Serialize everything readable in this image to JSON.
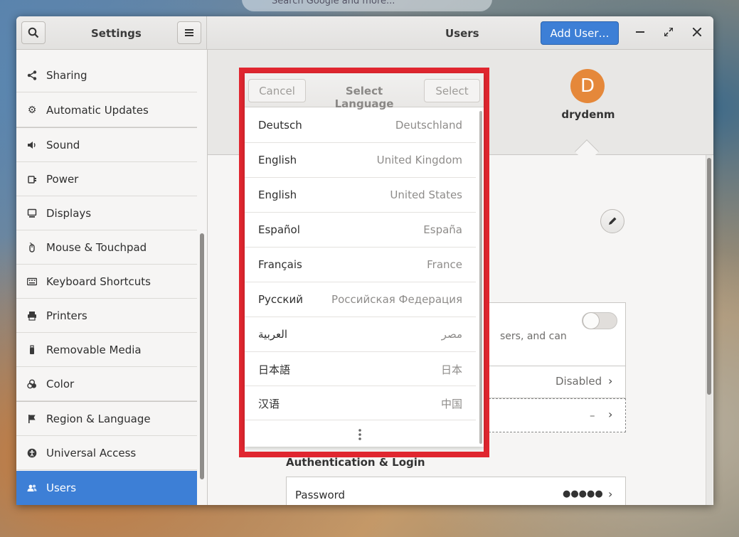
{
  "top_search": {
    "placeholder": "Search Google and more..."
  },
  "window": {
    "left_title": "Settings",
    "title": "Users",
    "add_user_label": "Add User…",
    "menu_icon": "hamburger-icon",
    "search_icon": "search-icon"
  },
  "sidebar": {
    "items": [
      {
        "label": "Sharing",
        "icon": "share-icon"
      },
      {
        "label": "Automatic Updates",
        "icon": "gear-icon"
      },
      {
        "label": "Sound",
        "icon": "speaker-icon"
      },
      {
        "label": "Power",
        "icon": "power-plug-icon"
      },
      {
        "label": "Displays",
        "icon": "display-icon"
      },
      {
        "label": "Mouse & Touchpad",
        "icon": "mouse-icon"
      },
      {
        "label": "Keyboard Shortcuts",
        "icon": "keyboard-icon"
      },
      {
        "label": "Printers",
        "icon": "printer-icon"
      },
      {
        "label": "Removable Media",
        "icon": "usb-icon"
      },
      {
        "label": "Color",
        "icon": "color-icon"
      },
      {
        "label": "Region & Language",
        "icon": "flag-icon"
      },
      {
        "label": "Universal Access",
        "icon": "accessibility-icon"
      },
      {
        "label": "Users",
        "icon": "users-icon",
        "active": true
      }
    ]
  },
  "user": {
    "avatar_letter": "D",
    "name": "drydenm"
  },
  "account": {
    "admin_desc_fragment": "sers, and can",
    "auto_login_value": "Disabled",
    "language_value": "–",
    "section_auth": "Authentication & Login",
    "password_label": "Password",
    "password_value": "●●●●●"
  },
  "dialog": {
    "cancel_label": "Cancel",
    "title": "Select Language",
    "select_label": "Select",
    "languages": [
      {
        "name": "Deutsch",
        "region": "Deutschland"
      },
      {
        "name": "English",
        "region": "United Kingdom"
      },
      {
        "name": "English",
        "region": "United States"
      },
      {
        "name": "Español",
        "region": "España"
      },
      {
        "name": "Français",
        "region": "France"
      },
      {
        "name": "Русский",
        "region": "Российская Федерация"
      },
      {
        "name": "العربية",
        "region": "مصر"
      },
      {
        "name": "日本語",
        "region": "日本"
      },
      {
        "name": "汉语",
        "region": "中国"
      }
    ],
    "more_icon": "vertical-ellipsis-icon"
  },
  "colors": {
    "accent": "#3d7fd6",
    "highlight_frame": "#e0262f",
    "avatar": "#e5883a"
  }
}
